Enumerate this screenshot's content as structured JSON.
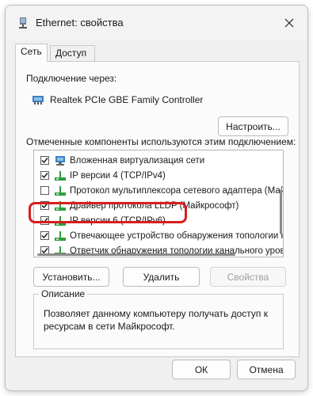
{
  "window": {
    "title": "Ethernet: свойства",
    "close_icon": "close-icon",
    "title_icon": "network-adapter-icon"
  },
  "tabs": [
    {
      "label": "Сеть",
      "active": true
    },
    {
      "label": "Доступ",
      "active": false
    }
  ],
  "connection": {
    "label": "Подключение через:",
    "adapter_name": "Realtek PCIe GBE Family Controller",
    "adapter_icon": "network-card-icon",
    "configure_button": "Настроить..."
  },
  "components": {
    "label": "Отмеченные компоненты используются этим подключением:",
    "items": [
      {
        "label": "Вложенная виртуализация сети",
        "checked": true,
        "icon": "network-service-icon"
      },
      {
        "label": "IP версии 4 (TCP/IPv4)",
        "checked": true,
        "icon": "protocol-icon"
      },
      {
        "label": "Протокол мультиплексора сетевого адаптера (Майк",
        "checked": false,
        "icon": "protocol-icon"
      },
      {
        "label": "Драйвер протокола LLDP (Майкрософт)",
        "checked": true,
        "icon": "protocol-icon"
      },
      {
        "label": "IP версии 6 (TCP/IPv6)",
        "checked": true,
        "icon": "protocol-icon"
      },
      {
        "label": "Отвечающее устройство обнаружения топологии к",
        "checked": true,
        "icon": "protocol-icon"
      },
      {
        "label": "Ответчик обнаружения топологии канального уров",
        "checked": true,
        "icon": "protocol-icon"
      }
    ],
    "highlight_color": "#d81e1e"
  },
  "actions": {
    "install": "Установить...",
    "remove": "Удалить",
    "properties": "Свойства"
  },
  "description": {
    "title": "Описание",
    "text": "Позволяет данному компьютеру получать доступ к ресурсам в сети Майкрософт."
  },
  "footer": {
    "ok": "ОК",
    "cancel": "Отмена"
  }
}
